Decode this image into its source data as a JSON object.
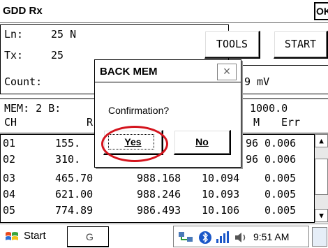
{
  "window": {
    "title": "GDD Rx",
    "ok_label": "OK"
  },
  "info": {
    "ln_label": "Ln:",
    "ln_value": "25 N",
    "tx_label": "Tx:",
    "tx_value": "25",
    "count_label": "Count:",
    "mv_value": "9 mV"
  },
  "buttons": {
    "tools": "TOOLS",
    "start": "START"
  },
  "mem": {
    "mem_label": "MEM: 2 B:",
    "range_value": "1000.0",
    "ch_header": "CH",
    "r_header": "R",
    "m_header": "M",
    "err_header": "Err"
  },
  "rows": [
    {
      "ch": "01",
      "col1": "155.",
      "col2": "",
      "col3": "96",
      "err": "0.006"
    },
    {
      "ch": "02",
      "col1": "310.",
      "col2": "",
      "col3": "96",
      "err": "0.006"
    },
    {
      "ch": "03",
      "col1": "465.70",
      "col2": "988.168",
      "col3": "10.094",
      "err": "0.005"
    },
    {
      "ch": "04",
      "col1": "621.00",
      "col2": "988.246",
      "col3": "10.093",
      "err": "0.005"
    },
    {
      "ch": "05",
      "col1": "774.89",
      "col2": "986.493",
      "col3": "10.106",
      "err": "0.005"
    }
  ],
  "dialog": {
    "title": "BACK MEM",
    "close": "×",
    "message": "Confirmation?",
    "yes": "Yes",
    "no": "No"
  },
  "taskbar": {
    "start": "Start",
    "task_fragment": "G",
    "time": "9:51 AM"
  },
  "icons": {
    "scroll_up": "▲",
    "scroll_down": "▼",
    "tray": [
      "network-icon",
      "bluetooth-icon",
      "volume-icon",
      "signal-icon"
    ]
  },
  "colors": {
    "highlight_circle": "#d4141d"
  }
}
